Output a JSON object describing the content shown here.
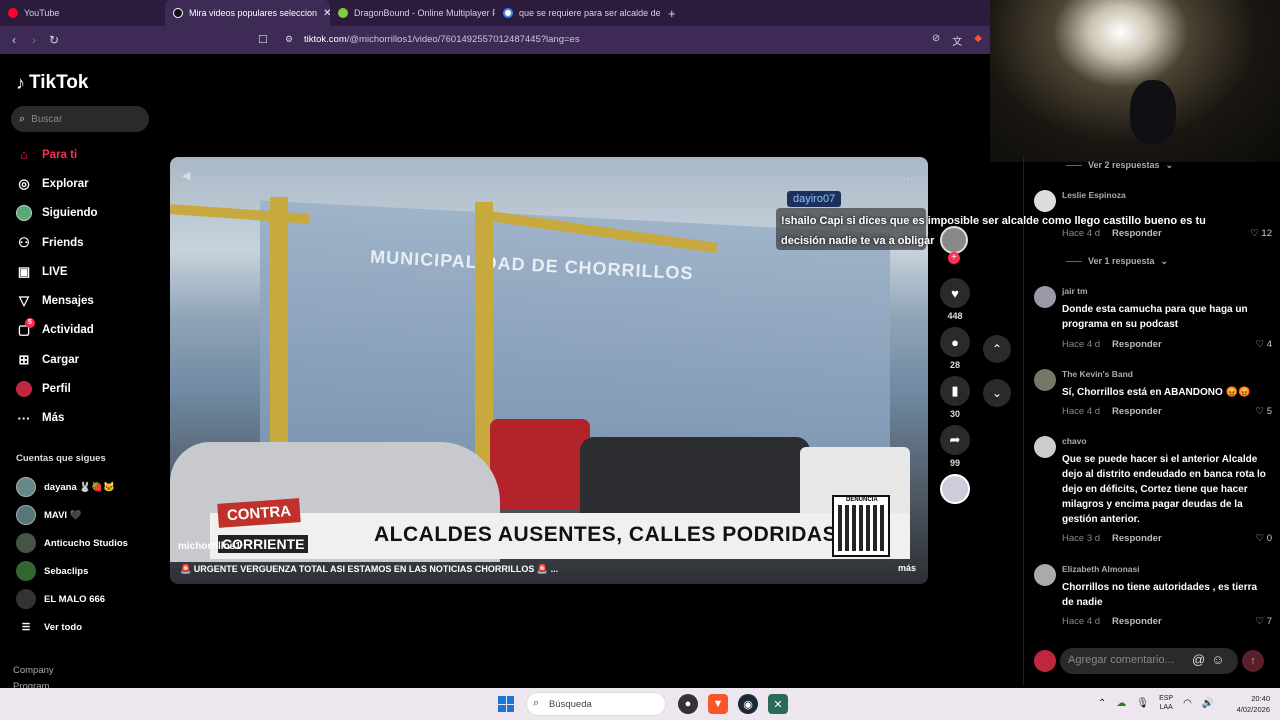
{
  "browser": {
    "tabs": [
      {
        "title": "YouTube",
        "color": "#ff0033"
      },
      {
        "title": "Mira videos populares seleccion",
        "color": "#ffffff",
        "active": true
      },
      {
        "title": "DragonBound - Online Multiplayer F",
        "color": "#7ecf3c"
      },
      {
        "title": "que se requiere para ser alcalde de",
        "color": "#4285f4"
      }
    ],
    "url_domain": "tiktok.com",
    "url_path": "/@michorrillos1/video/7601492557012487445?lang=es"
  },
  "sidebar": {
    "logo": "TikTok",
    "search_placeholder": "Buscar",
    "nav": [
      {
        "label": "Para ti",
        "icon": "home-icon",
        "active": true
      },
      {
        "label": "Explorar",
        "icon": "compass-icon"
      },
      {
        "label": "Siguiendo",
        "icon": "following-avatar-icon"
      },
      {
        "label": "Friends",
        "icon": "friends-icon"
      },
      {
        "label": "LIVE",
        "icon": "live-icon"
      },
      {
        "label": "Mensajes",
        "icon": "messages-icon"
      },
      {
        "label": "Actividad",
        "icon": "activity-icon",
        "badge": "5"
      },
      {
        "label": "Cargar",
        "icon": "upload-icon"
      },
      {
        "label": "Perfil",
        "icon": "profile-icon"
      },
      {
        "label": "Más",
        "icon": "more-icon"
      }
    ],
    "following_title": "Cuentas que sigues",
    "following": [
      {
        "name": "dayana 🐰🍓🐱"
      },
      {
        "name": "MAVI 🖤"
      },
      {
        "name": "Anticucho Studios"
      },
      {
        "name": "Sebaclips"
      },
      {
        "name": "EL MALO 666"
      }
    ],
    "see_all": "Ver todo",
    "footer": [
      "Company",
      "Program"
    ]
  },
  "video": {
    "building_sign": "MUNICIPALIDAD DE CHORRILLOS",
    "banner_text": "ALCALDES AUSENTES, CALLES PODRIDAS",
    "logo_top": "CONTRA",
    "logo_bottom": "CORRIENTE",
    "qr_label": "DENUNCIA",
    "author": "michorrillos1",
    "caption": "🚨 URGENTE VERGUENZA TOTAL ASI ESTAMOS EN LAS NOTICIAS CHORRILLOS 🚨 ...",
    "more": "más",
    "likes": "448",
    "comments": "28",
    "saves": "30",
    "shares": "99"
  },
  "chat_overlay": {
    "user": "dayiro07",
    "message": "!shailo Capi si dices que es imposible ser alcalde como llego castillo bueno es tu decisión nadie te va a obligar"
  },
  "comments": {
    "top_replies": "Ver 2 respuestas",
    "items": [
      {
        "user": "Leslie Espinoza",
        "text": "",
        "time": "Hace 4 d",
        "likes": "12",
        "replies": "Ver 1 respuesta"
      },
      {
        "user": "jair tm",
        "text": "Donde esta camucha para que haga un programa en su podcast",
        "time": "Hace 4 d",
        "likes": "4"
      },
      {
        "user": "The Kevin's Band",
        "text": "Sí, Chorrillos está en ABANDONO 😡😡",
        "time": "Hace 4 d",
        "likes": "5"
      },
      {
        "user": "chavo",
        "text": "Que se puede hacer si el anterior Alcalde dejo al distrito endeudado en banca rota lo dejo en déficits, Cortez tiene que hacer milagros y encima pagar deudas de la gestión anterior.",
        "time": "Hace 3 d",
        "likes": "0"
      },
      {
        "user": "Elizabeth Almonasi",
        "text": "Chorrillos no tiene autoridades , es tierra de nadie",
        "time": "Hace 4 d",
        "likes": "7"
      }
    ],
    "reply_label": "Responder",
    "input_placeholder": "Agregar comentario..."
  },
  "taskbar": {
    "search_placeholder": "Búsqueda",
    "lang_top": "ESP",
    "lang_bottom": "LAA",
    "time": "20:40",
    "date": "4/02/2026"
  }
}
